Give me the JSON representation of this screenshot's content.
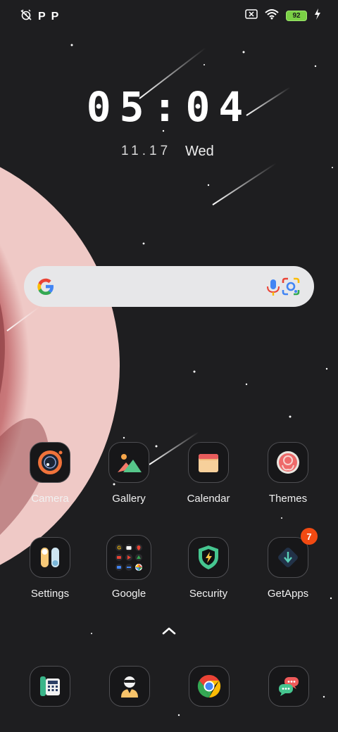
{
  "status_bar": {
    "left_icons": [
      "alarm-off-icon",
      "p-notification-icon",
      "p-notification-icon"
    ],
    "notifications": [
      "P",
      "P"
    ],
    "right_icons": [
      "screen-x-icon",
      "wifi-icon",
      "battery-icon",
      "charging-bolt-icon"
    ],
    "battery_level": "92"
  },
  "clock": {
    "time": "05:04",
    "date": "11.17",
    "day": "Wed"
  },
  "search_bar": {
    "logo": "google-g-icon",
    "mic": "mic-icon",
    "lens": "lens-icon"
  },
  "apps": [
    {
      "label": "Camera",
      "icon": "camera-icon"
    },
    {
      "label": "Gallery",
      "icon": "gallery-icon"
    },
    {
      "label": "Calendar",
      "icon": "calendar-icon"
    },
    {
      "label": "Themes",
      "icon": "themes-icon"
    },
    {
      "label": "Settings",
      "icon": "settings-icon"
    },
    {
      "label": "Google",
      "icon": "google-folder-icon"
    },
    {
      "label": "Security",
      "icon": "security-icon"
    },
    {
      "label": "GetApps",
      "icon": "getapps-icon",
      "badge": "7"
    }
  ],
  "dock": [
    {
      "icon": "phone-icon"
    },
    {
      "icon": "contacts-icon"
    },
    {
      "icon": "chrome-icon"
    },
    {
      "icon": "messages-icon"
    }
  ],
  "colors": {
    "background": "#1e1e20",
    "planet": "#b86060",
    "search_bar": "#e7e7e9",
    "badge": "#f24a12",
    "battery": "#7ad045"
  }
}
